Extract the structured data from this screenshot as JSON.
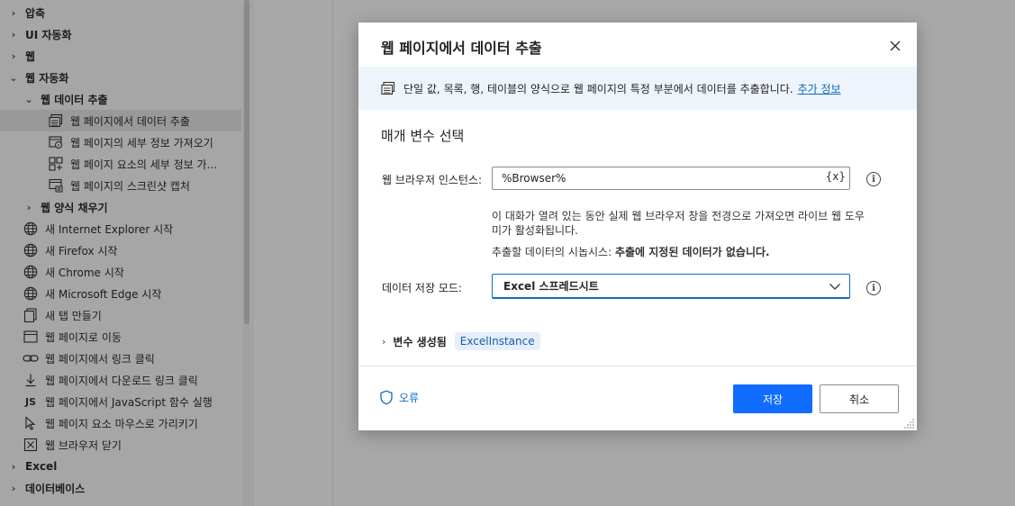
{
  "tree": {
    "items": [
      {
        "chevron": "›",
        "label": "압축",
        "bold": true,
        "indent": 0,
        "icon": ""
      },
      {
        "chevron": "›",
        "label": "UI 자동화",
        "bold": true,
        "indent": 0,
        "icon": ""
      },
      {
        "chevron": "›",
        "label": "웹",
        "bold": true,
        "indent": 0,
        "icon": ""
      },
      {
        "chevron": "⌄",
        "label": "웹 자동화",
        "bold": true,
        "indent": 0,
        "icon": ""
      },
      {
        "chevron": "⌄",
        "label": "웹 데이터 추출",
        "bold": true,
        "indent": 1,
        "icon": ""
      },
      {
        "chevron": "",
        "label": "웹 페이지에서 데이터 추출",
        "bold": false,
        "indent": 2,
        "icon": "extract-data-icon",
        "selected": true
      },
      {
        "chevron": "",
        "label": "웹 페이지의 세부 정보 가져오기",
        "bold": false,
        "indent": 2,
        "icon": "page-details-icon"
      },
      {
        "chevron": "",
        "label": "웹 페이지 요소의 세부 정보 가...",
        "bold": false,
        "indent": 2,
        "icon": "element-details-icon"
      },
      {
        "chevron": "",
        "label": "웹 페이지의 스크린샷 캡처",
        "bold": false,
        "indent": 2,
        "icon": "screenshot-icon"
      },
      {
        "chevron": "›",
        "label": "웹 양식 채우기",
        "bold": true,
        "indent": 1,
        "icon": ""
      },
      {
        "chevron": "",
        "label": "새 Internet Explorer 시작",
        "bold": false,
        "indent": 1,
        "icon": "globe-icon"
      },
      {
        "chevron": "",
        "label": "새 Firefox 시작",
        "bold": false,
        "indent": 1,
        "icon": "globe-icon"
      },
      {
        "chevron": "",
        "label": "새 Chrome 시작",
        "bold": false,
        "indent": 1,
        "icon": "globe-icon"
      },
      {
        "chevron": "",
        "label": "새 Microsoft Edge 시작",
        "bold": false,
        "indent": 1,
        "icon": "globe-icon"
      },
      {
        "chevron": "",
        "label": "새 탭 만들기",
        "bold": false,
        "indent": 1,
        "icon": "new-tab-icon"
      },
      {
        "chevron": "",
        "label": "웹 페이지로 이동",
        "bold": false,
        "indent": 1,
        "icon": "browser-window-icon"
      },
      {
        "chevron": "",
        "label": "웹 페이지에서 링크 클릭",
        "bold": false,
        "indent": 1,
        "icon": "link-icon"
      },
      {
        "chevron": "",
        "label": "웹 페이지에서 다운로드 링크 클릭",
        "bold": false,
        "indent": 1,
        "icon": "download-icon"
      },
      {
        "chevron": "",
        "label": "웹 페이지에서 JavaScript 함수 실행",
        "bold": false,
        "indent": 1,
        "icon": "js-icon"
      },
      {
        "chevron": "",
        "label": "웹 페이지 요소 마우스로 가리키기",
        "bold": false,
        "indent": 1,
        "icon": "cursor-icon"
      },
      {
        "chevron": "",
        "label": "웹 브라우저 닫기",
        "bold": false,
        "indent": 1,
        "icon": "close-box-icon"
      },
      {
        "chevron": "›",
        "label": "Excel",
        "bold": true,
        "indent": 0,
        "icon": ""
      },
      {
        "chevron": "›",
        "label": "데이터베이스",
        "bold": true,
        "indent": 0,
        "icon": ""
      }
    ],
    "js_glyph": "JS"
  },
  "dialog": {
    "title": "웹 페이지에서 데이터 추출",
    "close_glyph": "✕",
    "banner_text": "단일 값, 목록, 행, 테이블의 양식으로 웹 페이지의 특정 부분에서 데이터를 추출합니다.",
    "banner_link": "추가 정보",
    "section_title": "매개 변수 선택",
    "browser_label": "웹 브라우저 인스턴스:",
    "browser_value": "%Browser%",
    "var_glyph": "{x}",
    "help_glyph": "i",
    "hint_line1": "이 대화가 열려 있는 동안 실제 웹 브라우저 창을 전경으로 가져오면 라이브 웹 도우",
    "hint_line2": "미가 활성화됩니다.",
    "preview_label": "추출할 데이터의 시놉시스:",
    "preview_value": "추출에 지정된 데이터가 없습니다.",
    "storage_label": "데이터 저장 모드:",
    "storage_value": "Excel 스프레드시트",
    "vars_chevron": "›",
    "vars_label": "변수 생성됨",
    "vars_pill": "ExcelInstance",
    "error_label": "오류",
    "save_label": "저장",
    "cancel_label": "취소"
  },
  "colors": {
    "accent": "#0f6cbd",
    "primary_button": "#0f6cff",
    "banner_bg": "#eef4fb",
    "overlay": "#a8a8a8"
  }
}
